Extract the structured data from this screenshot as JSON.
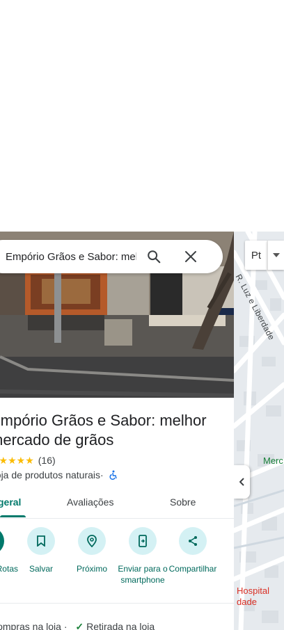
{
  "search": {
    "value": "Empório Grãos e Sabor: melhor mercado de grãos"
  },
  "place": {
    "title": "Empório Grãos e Sabor: melhor mercado de grãos",
    "stars": "★★★★★",
    "rating_count": "(16)",
    "category": "Loja de produtos naturais",
    "category_sep": " · "
  },
  "tabs": {
    "overview": "Visão geral",
    "reviews": "Avaliações",
    "about": "Sobre"
  },
  "actions": {
    "directions": "Rotas",
    "save": "Salvar",
    "nearby": "Próximo",
    "send": "Enviar para o smartphone",
    "share": "Compartilhar"
  },
  "service_options": {
    "first": "Compras na loja",
    "sep": " · ",
    "check": "✓",
    "second": "Retirada na loja"
  },
  "map": {
    "map_type_label": "Pt",
    "street_label": "R. Luz e Liberdade",
    "market_label": "Merc",
    "hospital_line1": "Hospital",
    "hospital_line2": "dade"
  },
  "colors": {
    "accent": "#00796b",
    "action_bg": "#d4f1f4",
    "star": "#fbbc04",
    "map_bg": "#e8ecef"
  }
}
